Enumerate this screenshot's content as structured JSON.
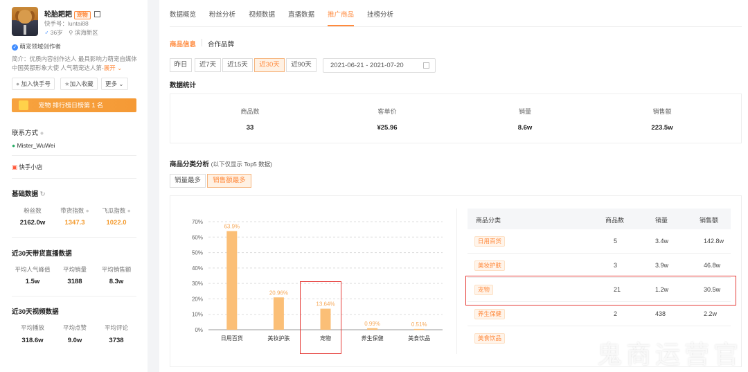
{
  "profile": {
    "name": "轮胎耙耙",
    "pet_tag": "宠物",
    "kuaishou_id": "快手号：luntai88",
    "age": "36岁",
    "location": "滨海新区",
    "verified": "萌宠领域创作者",
    "intro": "简介：优质内容创作达人 最具影响力萌宠自媒体 中国英都形象大使 人气萌宠达人第-",
    "expand": "展开",
    "btn_add_kuaishou": "加入快手号",
    "btn_add_favorite": "加入收藏",
    "btn_more": "更多",
    "rank_text": "宠物 排行榜日榜第 1 名"
  },
  "contact": {
    "title": "联系方式",
    "wechat": "Mister_WuWei",
    "shop": "快手小店"
  },
  "basic": {
    "title": "基础数据",
    "items": [
      {
        "label": "粉丝数",
        "value": "2162.0w"
      },
      {
        "label": "带货指数",
        "value": "1347.3"
      },
      {
        "label": "飞瓜指数",
        "value": "1022.0"
      }
    ]
  },
  "live30": {
    "title": "近30天带货直播数据",
    "items": [
      {
        "label": "平均人气峰值",
        "value": "1.5w"
      },
      {
        "label": "平均销量",
        "value": "3188"
      },
      {
        "label": "平均销售额",
        "value": "8.3w"
      }
    ]
  },
  "video30": {
    "title": "近30天视频数据",
    "items": [
      {
        "label": "平均播放",
        "value": "318.6w"
      },
      {
        "label": "平均点赞",
        "value": "9.0w"
      },
      {
        "label": "平均评论",
        "value": "3738"
      }
    ]
  },
  "tabs": [
    "数据概览",
    "粉丝分析",
    "视频数据",
    "直播数据",
    "推广商品",
    "挂榜分析"
  ],
  "subtabs": [
    "商品信息",
    "合作品牌"
  ],
  "periods": [
    "昨日",
    "近7天",
    "近15天",
    "近30天",
    "近90天"
  ],
  "date_range": "2021-06-21  -  2021-07-20",
  "stats_title": "数据统计",
  "summary": [
    {
      "label": "商品数",
      "value": "33"
    },
    {
      "label": "客单价",
      "value": "¥25.96"
    },
    {
      "label": "销量",
      "value": "8.6w"
    },
    {
      "label": "销售额",
      "value": "223.5w"
    }
  ],
  "category_title": "商品分类分析",
  "category_note": "(以下仅显示 Top5 数据)",
  "sort_buttons": [
    "销量最多",
    "销售额最多"
  ],
  "table": {
    "headers": [
      "商品分类",
      "商品数",
      "销量",
      "销售额"
    ],
    "rows": [
      [
        "日用百货",
        "5",
        "3.4w",
        "142.8w"
      ],
      [
        "美妆护肤",
        "3",
        "3.9w",
        "46.8w"
      ],
      [
        "宠物",
        "21",
        "1.2w",
        "30.5w"
      ],
      [
        "养生保健",
        "2",
        "438",
        "2.2w"
      ],
      [
        "美食饮品",
        "",
        "",
        ""
      ]
    ]
  },
  "chart_data": {
    "type": "bar",
    "categories": [
      "日用百货",
      "美妆护肤",
      "宠物",
      "养生保健",
      "美食饮品"
    ],
    "values": [
      63.9,
      20.96,
      13.64,
      0.99,
      0.51
    ],
    "data_labels": [
      "63.9%",
      "20.96%",
      "13.64%",
      "0.99%",
      "0.51%"
    ],
    "y_ticks": [
      "0%",
      "10%",
      "20%",
      "30%",
      "40%",
      "50%",
      "60%",
      "70%"
    ],
    "ylim": [
      0,
      70
    ],
    "bar_color": "#fbbf77",
    "label_color": "#f6a95a"
  },
  "watermark": "鬼商运营官",
  "colors": {
    "accent": "#ff8a3d",
    "highlight_box": "#e53935"
  }
}
